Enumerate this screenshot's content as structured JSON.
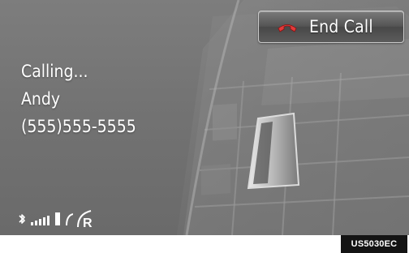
{
  "call": {
    "status": "Calling...",
    "contact_name": "Andy",
    "phone_number": "(555)555-5555"
  },
  "end_call_button": {
    "label": "End Call",
    "icon": "handset-hang-up-icon"
  },
  "status_bar": {
    "bluetooth_icon": "bluetooth-icon",
    "signal_icon": "signal-strength-icon",
    "battery_icon": "battery-icon",
    "roaming_indicator": "R"
  },
  "image_code": "US5030EC",
  "colors": {
    "screen_background": "#737373",
    "text": "#ffffff",
    "button_border": "#c9c9c9",
    "code_background": "#141414"
  }
}
